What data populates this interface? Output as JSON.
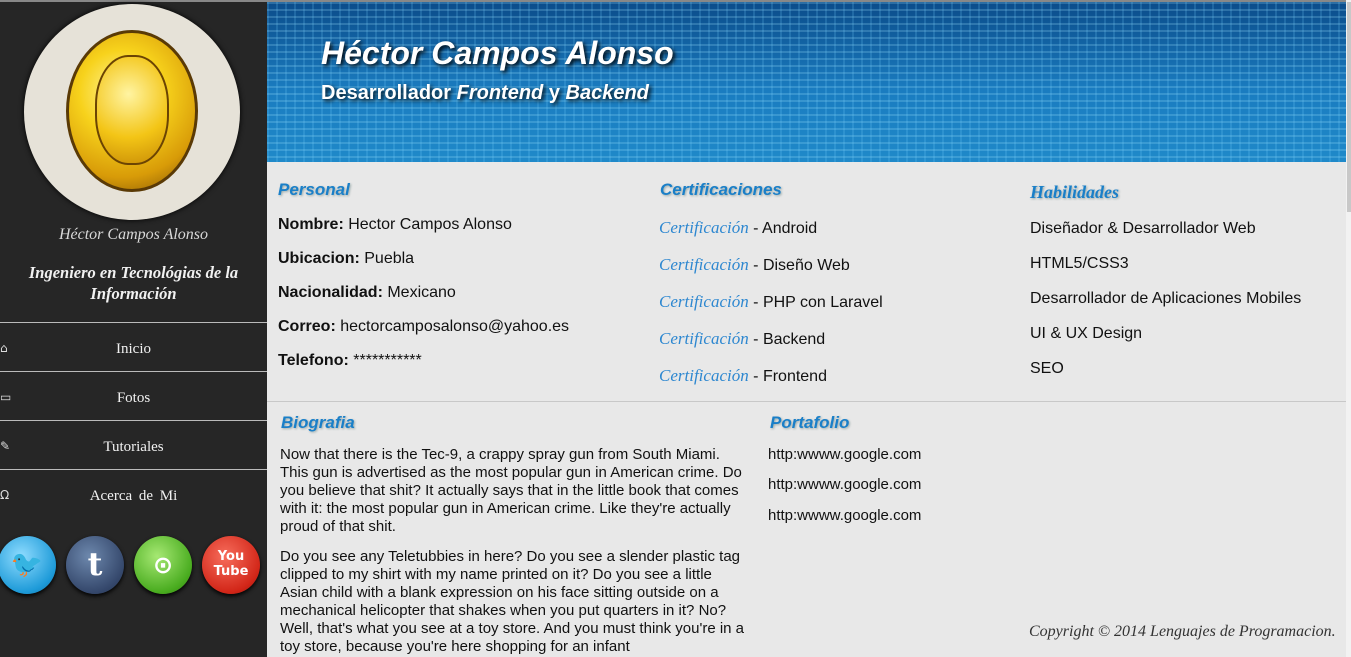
{
  "sidebar": {
    "name": "Héctor Campos Alonso",
    "title": "Ingeniero en Tecnológias de la Información",
    "nav": [
      {
        "label": "Inicio",
        "icon": "home-icon",
        "glyph": "⌂"
      },
      {
        "label": "Fotos",
        "icon": "image-icon",
        "glyph": "▭"
      },
      {
        "label": "Tutoriales",
        "icon": "feather-icon",
        "glyph": "✎"
      },
      {
        "label": "Acerca de Mi",
        "icon": "omega-icon",
        "glyph": "Ω"
      }
    ],
    "socials": [
      {
        "name": "twitter",
        "glyph": "🐦"
      },
      {
        "name": "tumblr",
        "glyph": "t"
      },
      {
        "name": "github",
        "glyph": "⊙"
      },
      {
        "name": "youtube",
        "glyph": "You Tube"
      }
    ]
  },
  "header": {
    "name": "Héctor Campos Alonso",
    "role_prefix": "Desarrollador ",
    "role_frontend": "Frontend",
    "role_and": " y ",
    "role_backend": "Backend"
  },
  "personal": {
    "heading": "Personal",
    "fields": [
      {
        "label": "Nombre:",
        "value": " Hector Campos Alonso"
      },
      {
        "label": "Ubicacion:",
        "value": " Puebla"
      },
      {
        "label": "Nacionalidad:",
        "value": " Mexicano"
      },
      {
        "label": "Correo:",
        "value": " hectorcamposalonso@yahoo.es"
      },
      {
        "label": "Telefono:",
        "value": " ***********"
      }
    ]
  },
  "certificaciones": {
    "heading": "Certificaciones",
    "link_label": "Certificación",
    "items": [
      " - Android",
      " - Diseño Web",
      " - PHP con Laravel",
      " - Backend",
      " - Frontend"
    ]
  },
  "habilidades": {
    "heading": "Habilidades",
    "items": [
      "Diseñador & Desarrollador Web",
      "HTML5/CSS3",
      "Desarrollador de Aplicaciones Mobiles",
      "UI & UX Design",
      "SEO"
    ]
  },
  "biografia": {
    "heading": "Biografia",
    "paragraphs": [
      "Now that there is the Tec-9, a crappy spray gun from South Miami. This gun is advertised as the most popular gun in American crime. Do you believe that shit? It actually says that in the little book that comes with it: the most popular gun in American crime. Like they're actually proud of that shit.",
      "Do you see any Teletubbies in here? Do you see a slender plastic tag clipped to my shirt with my name printed on it? Do you see a little Asian child with a blank expression on his face sitting outside on a mechanical helicopter that shakes when you put quarters in it? No? Well, that's what you see at a toy store. And you must think you're in a toy store, because you're here shopping for an infant"
    ]
  },
  "portafolio": {
    "heading": "Portafolio",
    "links": [
      "http:wwww.google.com",
      "http:wwww.google.com",
      "http:wwww.google.com"
    ]
  },
  "footer": {
    "copyright": "Copyright © 2014 Lenguajes de Programacion."
  }
}
